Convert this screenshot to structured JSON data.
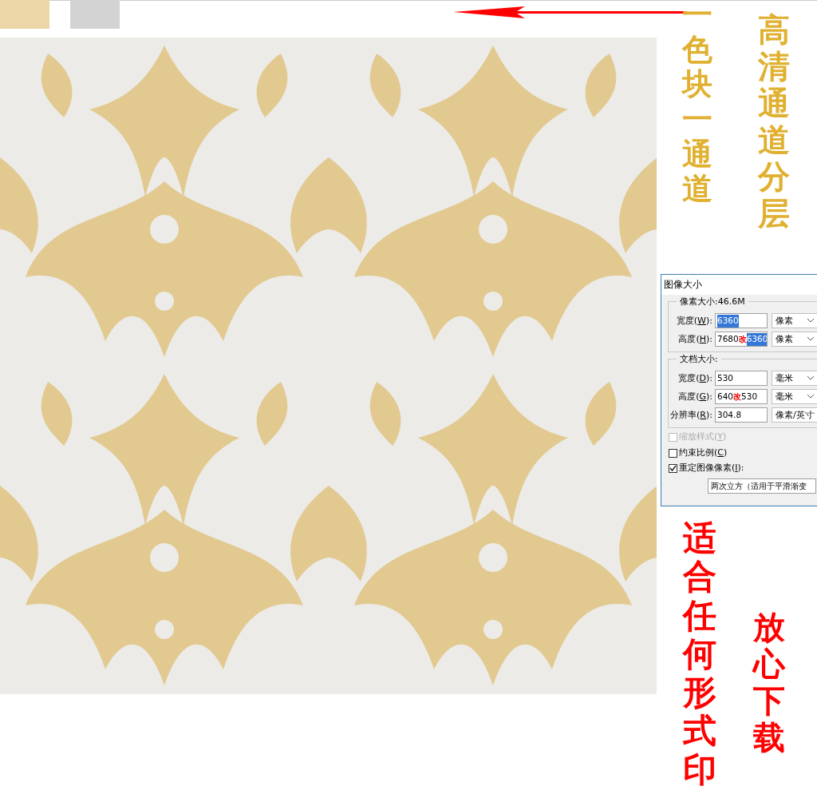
{
  "swatches": [
    {
      "color": "#ecd6a8"
    },
    {
      "color": "#d3d3d3"
    }
  ],
  "captions": [
    {
      "text": "一色块一通道",
      "color": "#e0b030"
    },
    {
      "text": "高清通道分层",
      "color": "#e0b030"
    },
    {
      "text": "适合任何形式印",
      "color": "#ff0000"
    },
    {
      "text": "放心下载",
      "color": "#ff0000"
    }
  ],
  "dialog": {
    "title": "图像大小",
    "pixel_group": {
      "title": "像素大小:46.6M",
      "rows": [
        {
          "label": "宽度(W):",
          "value": "6360",
          "mark": "",
          "new_value": "",
          "selected": true,
          "unit": "像素"
        },
        {
          "label": "高度(H):",
          "value": "7680",
          "mark": "改",
          "new_value": "6360",
          "selected": true,
          "unit": "像素"
        }
      ]
    },
    "document_group": {
      "title": "文档大小:",
      "rows": [
        {
          "label": "宽度(D):",
          "value": "530",
          "mark": "",
          "new_value": "",
          "selected": false,
          "unit": "毫米"
        },
        {
          "label": "高度(G):",
          "value": "640",
          "mark": "改",
          "new_value": "530",
          "selected": false,
          "unit": "毫米"
        },
        {
          "label": "分辨率(R):",
          "value": "304.8",
          "mark": "",
          "new_value": "",
          "selected": false,
          "unit": "像素/英寸"
        }
      ]
    },
    "options": [
      {
        "label": "缩放样式(Y)",
        "checked": false,
        "disabled": true
      },
      {
        "label": "约束比例(C)",
        "checked": false,
        "disabled": false
      },
      {
        "label": "重定图像像素(I):",
        "checked": true,
        "disabled": false
      }
    ],
    "resample": "两次立方（适用于平滑渐变"
  }
}
